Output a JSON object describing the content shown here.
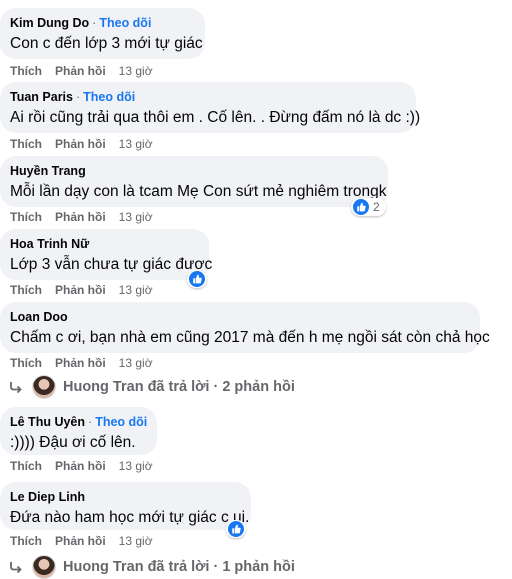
{
  "actions": {
    "like": "Thích",
    "reply": "Phản hồi"
  },
  "comments": [
    {
      "name": "Kim Dung Do",
      "follow": "Theo dõi",
      "text": "Con c đến lớp 3 mới tự giác",
      "time": "13 giờ"
    },
    {
      "name": "Tuan Paris",
      "follow": "Theo dõi",
      "text": "Ai rồi cũng trải qua thôi em . Cố lên. . Đừng đấm nó là dc :))",
      "time": "13 giờ"
    },
    {
      "name": "Huyền Trang",
      "text": "Mỗi lần dạy con là tcam Mẹ Con sứt mẻ nghiêm trongk",
      "time": "13 giờ",
      "reactions": "2"
    },
    {
      "name": "Hoa Trinh Nữ",
      "text": "Lớp 3 vẫn chưa tự giác được",
      "time": "13 giờ"
    },
    {
      "name": "Loan Doo",
      "text": "Chấm c ơi, bạn nhà em cũng 2017 mà đến h mẹ ngồi sát còn chả học",
      "time": "13 giờ",
      "reply": {
        "author": "Huong Tran",
        "text": "Huong Tran đã trả lời · 2 phản hồi"
      }
    },
    {
      "name": "Lê Thu Uyên",
      "follow": "Theo dõi",
      "text": ":)))) Đậu ơi cố lên.",
      "time": "13 giờ"
    },
    {
      "name": "Le Diep Linh",
      "text": "Đứa nào ham học mới tự giác c ui.",
      "time": "13 giờ",
      "reply": {
        "author": "Huong Tran",
        "text": "Huong Tran đã trả lời · 1 phản hồi"
      }
    }
  ],
  "colors": {
    "bubble": "#f0f2f5",
    "link": "#1877f2",
    "secondary": "#65676b"
  }
}
